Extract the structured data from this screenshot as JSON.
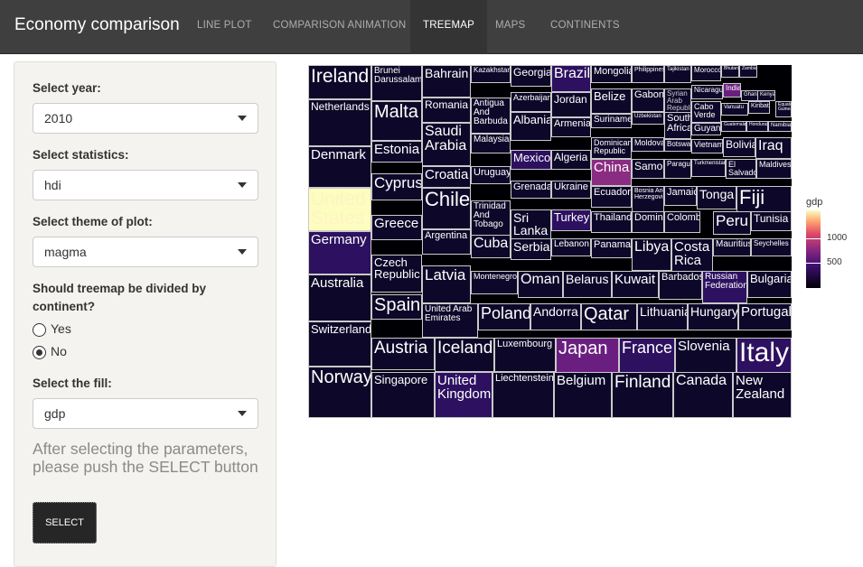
{
  "app": {
    "title": "Economy comparison",
    "tabs": [
      {
        "label": "LINE PLOT",
        "active": false
      },
      {
        "label": "COMPARISON ANIMATION",
        "active": false
      },
      {
        "label": "TREEMAP",
        "active": true
      },
      {
        "label": "MAPS",
        "active": false
      },
      {
        "label": "CONTINENTS",
        "active": false
      }
    ]
  },
  "sidebar": {
    "year_label": "Select year:",
    "year_value": "2010",
    "stat_label": "Select statistics:",
    "stat_value": "hdi",
    "theme_label": "Select theme of plot:",
    "theme_value": "magma",
    "divide_label": "Should treemap be divided by continent?",
    "divide_options": [
      {
        "label": "Yes",
        "selected": false
      },
      {
        "label": "No",
        "selected": true
      }
    ],
    "fill_label": "Select the fill:",
    "fill_value": "gdp",
    "hint": "After selecting the parameters, please push the SELECT button",
    "select_button": "SELECT"
  },
  "legend": {
    "title": "gdp",
    "ticks": [
      "1000",
      "500"
    ]
  },
  "colors": {
    "navbar": "#3f3f3f",
    "active_tab": "#343434",
    "sidebar_bg": "#f5f3ef",
    "tile_dark": "#0d0829",
    "tile_purple": "#2d1160",
    "tile_magenta": "#6a1f80",
    "tile_pink": "#8a2c82",
    "tile_light": "#fcfdbf"
  },
  "treemap": {
    "labels": [
      "Ireland",
      "Brunei Darussalam",
      "Bahrain",
      "Kazakhstan",
      "Georgia",
      "Brazil",
      "Mongolia",
      "Philippines",
      "Tajikistan",
      "Morocco",
      "Bhutan",
      "Zambia",
      "Netherlands",
      "Malta",
      "Romania",
      "Antigua And Barbuda",
      "Azerbaijan",
      "Jordan",
      "Belize",
      "Gabon",
      "Syrian Arab Republic",
      "Nicaragua",
      "India",
      "Congo",
      "Kiribati",
      "Ghana",
      "Kenya",
      "Equatorial Guinea",
      "Suriname",
      "Uzbekistan",
      "South Africa",
      "Cabo Verde",
      "Vanuatu",
      "Guyana",
      "Guatemala",
      "Honduras",
      "Namibia",
      "Denmark",
      "Estonia",
      "Saudi Arabia",
      "Malaysia",
      "Albania",
      "Armenia",
      "Dominican Republic",
      "Moldova",
      "Botswana",
      "Vietnam",
      "Bolivia",
      "Iraq",
      "Mexico",
      "Algeria",
      "China",
      "Samoa",
      "Paraguay",
      "Turkmenistan",
      "El Salvador",
      "Maldives",
      "United States",
      "Cyprus",
      "Croatia",
      "Uruguay",
      "Grenada",
      "Ukraine",
      "Ecuador",
      "Bosnia And Herzegovina",
      "Jamaica",
      "Tonga",
      "Fiji",
      "Chile",
      "Trinidad And Tobago",
      "Sri Lanka",
      "Turkey",
      "Thailand",
      "Dominica",
      "Colombia",
      "Peru",
      "Tunisia",
      "Greece",
      "Germany",
      "Argentina",
      "Cuba",
      "Serbia",
      "Lebanon",
      "Panama",
      "Libya",
      "Costa Rica",
      "Mauritius",
      "Seychelles",
      "Australia",
      "Czech Republic",
      "Latvia",
      "Montenegro",
      "Oman",
      "Belarus",
      "Kuwait",
      "Barbados",
      "Russian Federation",
      "Bulgaria",
      "Switzerland",
      "Spain",
      "United Arab Emirates",
      "Poland",
      "Andorra",
      "Qatar",
      "Lithuania",
      "Hungary",
      "Portugal",
      "Norway",
      "Austria",
      "Iceland",
      "Luxembourg",
      "Japan",
      "France",
      "Slovenia",
      "Italy",
      "Singapore",
      "United Kingdom",
      "Liechtenstein",
      "Belgium",
      "Finland",
      "Canada",
      "New Zealand"
    ]
  }
}
